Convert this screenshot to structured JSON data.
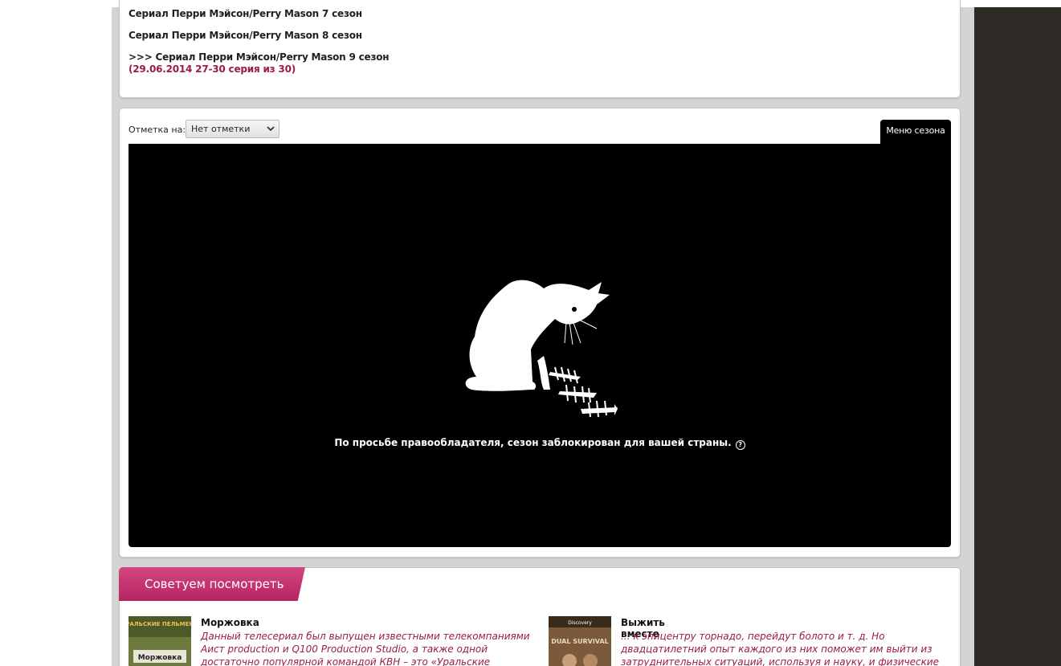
{
  "seasons_list": {
    "items": [
      {
        "label": "Сериал Перри Мэйсон/Perry Mason 7 сезон"
      },
      {
        "label": "Сериал Перри Мэйсон/Perry Mason 8 сезон"
      },
      {
        "label": ">>> Сериал Перри Мэйсон/Perry Mason 9 сезон"
      }
    ],
    "current_date_note": "(29.06.2014 27-30 серия из 30)"
  },
  "player_panel": {
    "mark_label": "Отметка на:",
    "mark_select_value": "Нет отметки",
    "season_menu_label": "Меню сезона",
    "blocked_message": "По просьбе правообладателя, сезон заблокирован для вашей страны.",
    "help_icon_glyph": "?"
  },
  "recommendations": {
    "tab_label": "Советуем посмотреть",
    "items": [
      {
        "title": "Моржовка",
        "description": "Данный телесериал был выпущен известными телекомпаниями Аист production и Q100 Production Studio, а также одной достаточно популярной командой КВН – это «Уральские пельмени». Все события в данном",
        "thumb_text_top": "УРАЛЬСКИЕ ПЕЛЬМЕНИ",
        "thumb_text_bottom": "Моржовка"
      },
      {
        "title": "Выжить вместе",
        "description": "... к эпицентру торнадо, перейдут болото и т. д. Но двадцатилетний опыт каждого из них поможет им выйти из затруднительных ситуаций, используя и науку, и физические способности, и навыки человека.",
        "thumb_text_top": "Discovery",
        "thumb_text_bottom": "DUAL SURVIVAL"
      }
    ]
  },
  "colors": {
    "accent_pink": "#c0306d",
    "date_red": "#9b1b4a",
    "sidebar_dark": "#2d2925"
  }
}
